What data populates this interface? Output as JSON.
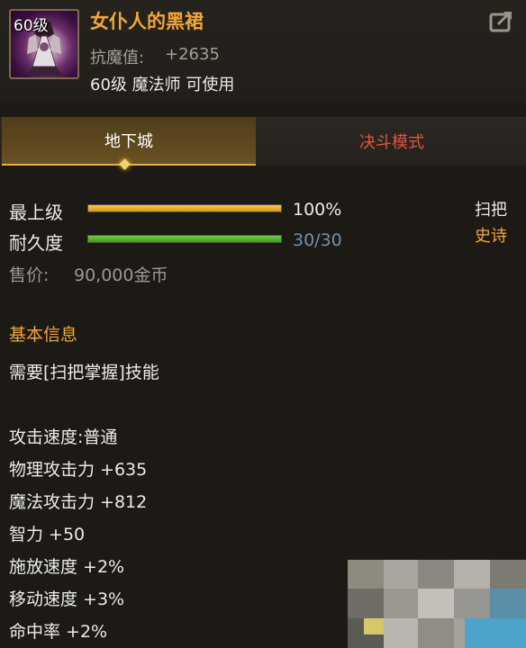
{
  "item": {
    "name": "女仆人的黑裙",
    "level_badge": "60级",
    "resist_label": "抗魔值:",
    "resist_value": "+2635",
    "requirement": "60级 魔法师 可使用"
  },
  "tabs": [
    {
      "label": "地下城",
      "active": true
    },
    {
      "label": "决斗模式",
      "active": false
    }
  ],
  "stats": {
    "grade": {
      "label": "最上级",
      "value": "100%",
      "fill": 1.0
    },
    "durability": {
      "label": "耐久度",
      "value": "30/30",
      "fill": 1.0
    }
  },
  "side_tags": {
    "type": "扫把",
    "rarity": "史诗"
  },
  "price": {
    "label": "售价:",
    "value": "90,000金币"
  },
  "info": {
    "title": "基本信息",
    "requirement": "需要[扫把掌握]技能",
    "attributes": [
      "攻击速度:普通",
      "物理攻击力 +635",
      "魔法攻击力 +812",
      "智力 +50",
      "施放速度 +2%",
      "移动速度 +3%",
      "命中率 +2%"
    ]
  },
  "colors": {
    "item_name": "#f0a73a",
    "rarity": "#f0a73a",
    "inactive_tab": "#e2553d",
    "durability_value": "#6f8fb0",
    "grade_bar": "#e8b634",
    "durability_bar": "#5bbb2f"
  },
  "icons": {
    "share": "share-arrow-icon",
    "item": "black-dress-item-icon"
  }
}
